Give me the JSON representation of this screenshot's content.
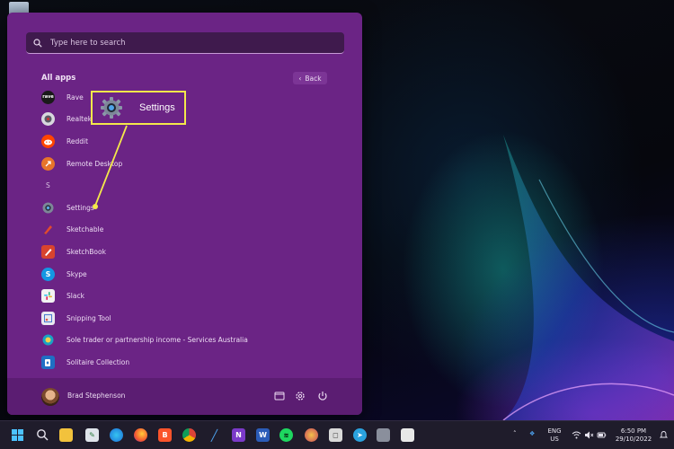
{
  "search": {
    "placeholder": "Type here to search"
  },
  "allapps": {
    "title": "All apps",
    "back_label": "Back"
  },
  "apps": [
    {
      "label": "Rave",
      "icon": "rave-icon"
    },
    {
      "label": "Realtek Audio Console",
      "icon": "realtek-icon"
    },
    {
      "label": "Reddit",
      "icon": "reddit-icon"
    },
    {
      "label": "Remote Desktop",
      "icon": "remote-desktop-icon"
    },
    {
      "letter": "S"
    },
    {
      "label": "Settings",
      "icon": "settings-gear-icon"
    },
    {
      "label": "Sketchable",
      "icon": "sketchable-icon"
    },
    {
      "label": "SketchBook",
      "icon": "sketchbook-icon"
    },
    {
      "label": "Skype",
      "icon": "skype-icon"
    },
    {
      "label": "Slack",
      "icon": "slack-icon"
    },
    {
      "label": "Snipping Tool",
      "icon": "snipping-tool-icon"
    },
    {
      "label": "Sole trader or partnership income - Services Australia",
      "icon": "services-australia-icon"
    },
    {
      "label": "Solitaire Collection",
      "icon": "solitaire-icon"
    }
  ],
  "user": {
    "name": "Brad Stephenson"
  },
  "callout": {
    "label": "Settings"
  },
  "tray": {
    "language_top": "ENG",
    "language_bottom": "US",
    "time": "6:50 PM",
    "date": "29/10/2022"
  },
  "colors": {
    "menu_bg": "#6b2485",
    "callout_border": "#f4e94a",
    "taskbar_bg": "#1f1c2b"
  }
}
